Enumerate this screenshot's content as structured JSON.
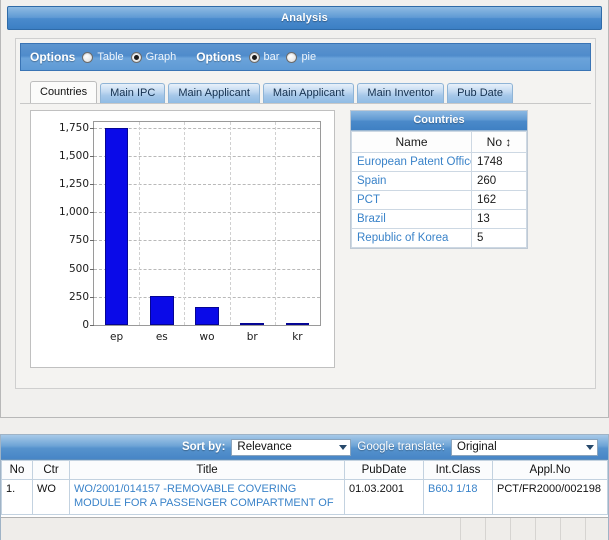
{
  "analysis": {
    "title": "Analysis",
    "options": {
      "label_1": "Options",
      "label_2": "Options",
      "view_modes": [
        {
          "label": "Table",
          "selected": false
        },
        {
          "label": "Graph",
          "selected": true
        }
      ],
      "chart_types": [
        {
          "label": "bar",
          "selected": true
        },
        {
          "label": "pie",
          "selected": false
        }
      ]
    },
    "tabs": [
      {
        "label": "Countries",
        "active": true
      },
      {
        "label": "Main IPC",
        "active": false
      },
      {
        "label": "Main Applicant",
        "active": false
      },
      {
        "label": "Main Applicant",
        "active": false
      },
      {
        "label": "Main Inventor",
        "active": false
      },
      {
        "label": "Pub Date",
        "active": false
      }
    ],
    "countries_table": {
      "caption": "Countries",
      "columns": [
        "Name",
        "No"
      ],
      "sort_glyph": "↕",
      "rows": [
        {
          "name": "European Patent Office",
          "no": "1748"
        },
        {
          "name": "Spain",
          "no": "260"
        },
        {
          "name": "PCT",
          "no": "162"
        },
        {
          "name": "Brazil",
          "no": "13"
        },
        {
          "name": "Republic of Korea",
          "no": "5"
        }
      ]
    }
  },
  "chart_data": {
    "type": "bar",
    "title": "",
    "xlabel": "",
    "ylabel": "",
    "categories": [
      "ep",
      "es",
      "wo",
      "br",
      "kr"
    ],
    "values": [
      1748,
      260,
      162,
      13,
      5
    ],
    "series": [
      {
        "name": "Countries",
        "values": [
          1748,
          260,
          162,
          13,
          5
        ]
      }
    ],
    "ylim": [
      0,
      1800
    ],
    "yticks": [
      0,
      250,
      500,
      750,
      1000,
      1250,
      1500,
      1750
    ],
    "ytick_labels": [
      "0",
      "250",
      "500",
      "750",
      "1,000",
      "1,250",
      "1,500",
      "1,750"
    ],
    "grid": true,
    "legend": "none",
    "bar_color": "#0a0ae8",
    "bar_border_color": "#050594"
  },
  "results": {
    "sort_by_label": "Sort by:",
    "sort_by_value": "Relevance",
    "translate_label": "Google translate:",
    "translate_value": "Original",
    "columns": [
      "No",
      "Ctr",
      "Title",
      "PubDate",
      "Int.Class",
      "Appl.No"
    ],
    "rows": [
      {
        "no": "1.",
        "ctr": "WO",
        "title": "WO/2001/014157 -REMOVABLE COVERING MODULE FOR A PASSENGER COMPARTMENT OF",
        "pubdate": "01.03.2001",
        "intclass": "B60J 1/18",
        "applno": "PCT/FR2000/002198"
      }
    ]
  }
}
